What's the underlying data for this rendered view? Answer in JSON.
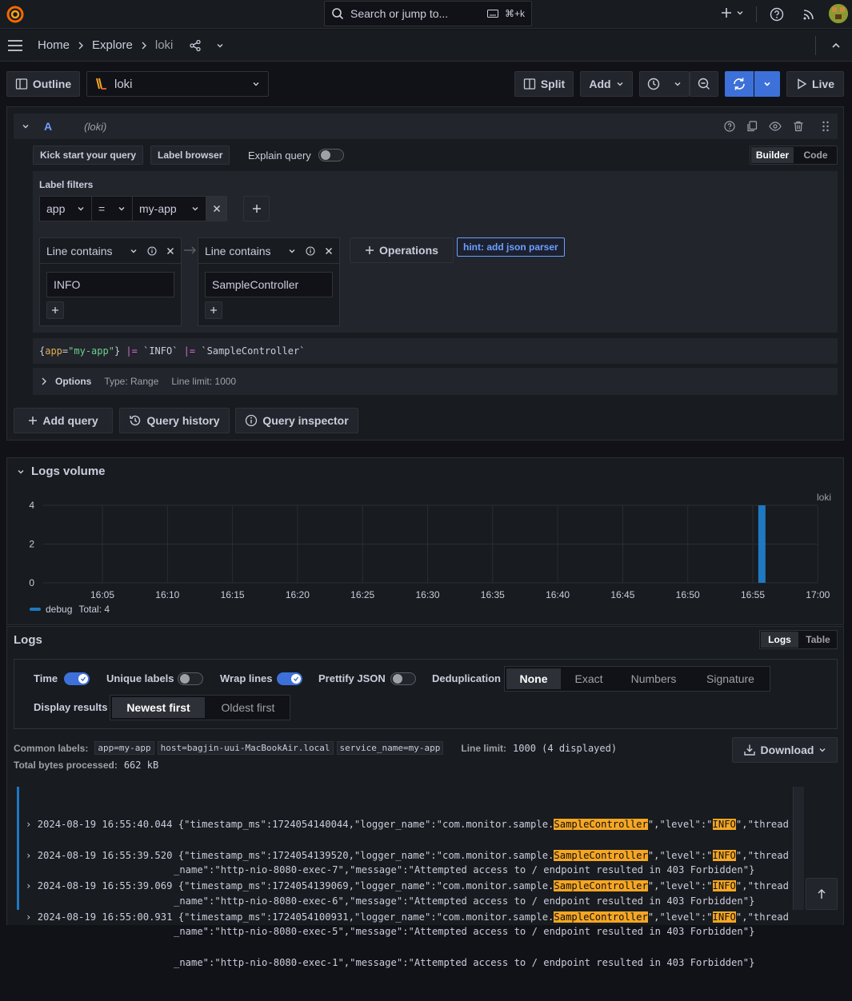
{
  "topbar": {
    "search_placeholder": "Search or jump to...",
    "search_shortcut": "⌘+k"
  },
  "breadcrumb": {
    "items": [
      "Home",
      "Explore",
      "loki"
    ]
  },
  "toolbar": {
    "outline_label": "Outline",
    "datasource": "loki",
    "split_label": "Split",
    "add_label": "Add",
    "live_label": "Live"
  },
  "query": {
    "ref_id": "A",
    "datasource_tag": "(loki)",
    "kick_start_label": "Kick start your query",
    "label_browser_label": "Label browser",
    "explain_label": "Explain query",
    "builder_label": "Builder",
    "code_label": "Code",
    "label_filters_title": "Label filters",
    "filter": {
      "label": "app",
      "operator": "=",
      "value": "my-app"
    },
    "ops": [
      {
        "title": "Line contains",
        "value": "INFO"
      },
      {
        "title": "Line contains",
        "value": "SampleController"
      }
    ],
    "operations_label": "Operations",
    "hint_label": "hint: add json parser",
    "expr_parts": [
      "{",
      "app",
      "=",
      "\"my-app\"",
      "}",
      " |= ",
      "`INFO`",
      " |= ",
      "`SampleController`"
    ],
    "options_label": "Options",
    "options_type": "Type: Range",
    "options_limit": "Line limit: 1000",
    "add_query_label": "Add query",
    "history_label": "Query history",
    "inspector_label": "Query inspector"
  },
  "logs_volume": {
    "title": "Logs volume",
    "series_label": "loki",
    "legend_name": "debug",
    "legend_total": "Total: 4"
  },
  "chart_data": {
    "type": "bar",
    "x_ticks": [
      "16:05",
      "16:10",
      "16:15",
      "16:20",
      "16:25",
      "16:30",
      "16:35",
      "16:40",
      "16:45",
      "16:50",
      "16:55",
      "17:00"
    ],
    "y_ticks": [
      "0",
      "2",
      "4"
    ],
    "ylim": [
      0,
      4
    ],
    "series": [
      {
        "name": "debug",
        "color": "#1f78c1",
        "points": [
          {
            "x": "16:55:40",
            "value": 4
          }
        ]
      }
    ]
  },
  "logs": {
    "title": "Logs",
    "view_logs_label": "Logs",
    "view_table_label": "Table",
    "time_label": "Time",
    "unique_labels_label": "Unique labels",
    "wrap_lines_label": "Wrap lines",
    "prettify_label": "Prettify JSON",
    "dedup_label": "Deduplication",
    "dedup_options": [
      "None",
      "Exact",
      "Numbers",
      "Signature"
    ],
    "display_results_label": "Display results",
    "order_options": [
      "Newest first",
      "Oldest first"
    ],
    "common_labels_label": "Common labels:",
    "common_labels": [
      "app=my-app",
      "host=bagjin-uui-MacBookAir.local",
      "service_name=my-app"
    ],
    "line_limit_label": "Line limit:",
    "line_limit_value": "1000 (4 displayed)",
    "total_bytes_label": "Total bytes processed:",
    "total_bytes_value": "662 kB",
    "download_label": "Download",
    "rows": [
      {
        "time": "2024-08-19 16:55:40.044",
        "line1": [
          "{\"timestamp_ms\":1724054140044,\"logger_name\":\"com.monitor.sample.",
          "SampleController",
          "\",\"level\":\"",
          "INFO",
          "\",\"thread"
        ],
        "line2": "_name\":\"http-nio-8080-exec-7\",\"message\":\"Attempted access to / endpoint resulted in 403 Forbidden\"}"
      },
      {
        "time": "2024-08-19 16:55:39.520",
        "line1": [
          "{\"timestamp_ms\":1724054139520,\"logger_name\":\"com.monitor.sample.",
          "SampleController",
          "\",\"level\":\"",
          "INFO",
          "\",\"thread"
        ],
        "line2": "_name\":\"http-nio-8080-exec-6\",\"message\":\"Attempted access to / endpoint resulted in 403 Forbidden\"}"
      },
      {
        "time": "2024-08-19 16:55:39.069",
        "line1": [
          "{\"timestamp_ms\":1724054139069,\"logger_name\":\"com.monitor.sample.",
          "SampleController",
          "\",\"level\":\"",
          "INFO",
          "\",\"thread"
        ],
        "line2": "_name\":\"http-nio-8080-exec-5\",\"message\":\"Attempted access to / endpoint resulted in 403 Forbidden\"}"
      },
      {
        "time": "2024-08-19 16:55:00.931",
        "line1": [
          "{\"timestamp_ms\":1724054100931,\"logger_name\":\"com.monitor.sample.",
          "SampleController",
          "\",\"level\":\"",
          "INFO",
          "\",\"thread"
        ],
        "line2": "_name\":\"http-nio-8080-exec-1\",\"message\":\"Attempted access to / endpoint resulted in 403 Forbidden\"}"
      }
    ]
  },
  "colors": {
    "accent": "#3d71d9",
    "highlight": "#f5a623",
    "log_level_bar": "#1f78c1",
    "label_key": "#e0b050",
    "label_value": "#6ccf8e",
    "pipe": "#d46ad4"
  }
}
